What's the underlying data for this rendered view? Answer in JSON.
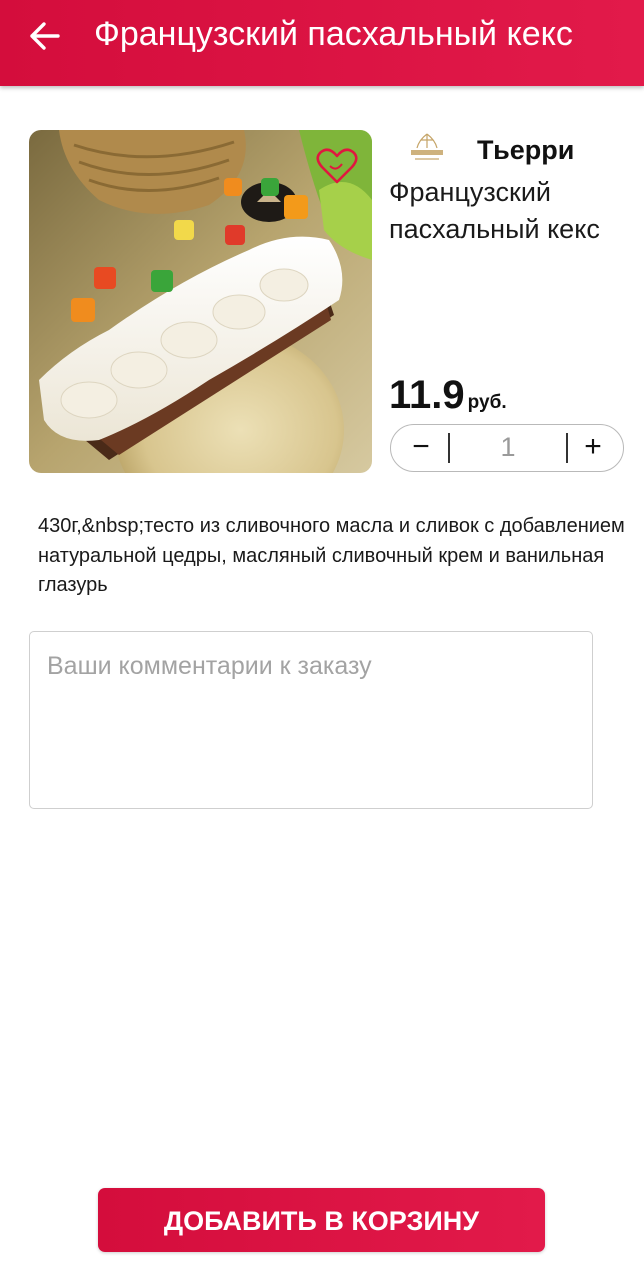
{
  "header": {
    "title": "Французский пасхальный кекс",
    "back_icon": "arrow-left-icon"
  },
  "product": {
    "image_icon": "cake-photo",
    "favorite_icon": "heart-outline-icon",
    "brand_logo_icon": "thierry-logo",
    "brand_name": "Тьерри",
    "name": "Французский пасхальный кекс",
    "price": "11.9",
    "currency": "руб.",
    "description": "430г,&nbsp;тесто из сливочного масла и сливок с добавлением натуральной цедры, масляный сливочный крем и ванильная глазурь"
  },
  "quantity": {
    "minus_label": "−",
    "value": "1",
    "plus_label": "+"
  },
  "comments": {
    "placeholder": "Ваши комментарии к заказу",
    "value": ""
  },
  "add_button": {
    "label": "ДОБАВИТЬ В КОРЗИНУ"
  },
  "colors": {
    "accent": "#d9113f",
    "favorite": "#e0173f"
  }
}
